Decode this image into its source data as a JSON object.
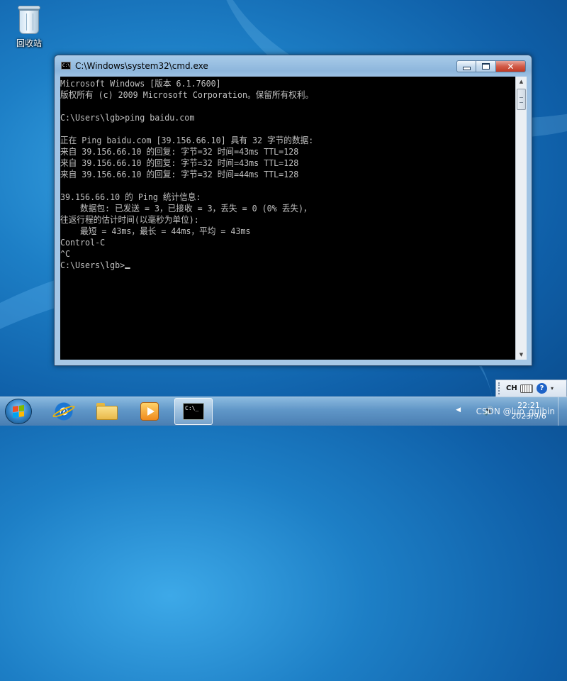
{
  "desktop": {
    "recycle_bin_label": "回收站"
  },
  "window": {
    "title": "C:\\Windows\\system32\\cmd.exe",
    "icon_text": "C:\\",
    "close_glyph": "✕"
  },
  "console": {
    "lines": [
      "Microsoft Windows [版本 6.1.7600]",
      "版权所有 (c) 2009 Microsoft Corporation。保留所有权利。",
      "",
      "C:\\Users\\lgb>ping baidu.com",
      "",
      "正在 Ping baidu.com [39.156.66.10] 具有 32 字节的数据:",
      "来自 39.156.66.10 的回复: 字节=32 时间=43ms TTL=128",
      "来自 39.156.66.10 的回复: 字节=32 时间=43ms TTL=128",
      "来自 39.156.66.10 的回复: 字节=32 时间=44ms TTL=128",
      "",
      "39.156.66.10 的 Ping 统计信息:",
      "    数据包: 已发送 = 3，已接收 = 3，丢失 = 0 (0% 丢失)，",
      "往返行程的估计时间(以毫秒为单位):",
      "    最短 = 43ms，最长 = 44ms，平均 = 43ms",
      "Control-C",
      "^C",
      "C:\\Users\\lgb>"
    ]
  },
  "language_bar": {
    "lang": "CH",
    "help": "?"
  },
  "taskbar": {
    "cmd_icon_text": "C:\\_",
    "clock_time": "22:21",
    "clock_date": "2023/9/6",
    "watermark": "CSDN @luo_guibin"
  },
  "colors": {
    "console_bg": "#000000",
    "console_fg": "#c0c0c0",
    "close_button": "#c13a24"
  },
  "icons": [
    "recycle-bin-icon",
    "cmd-icon",
    "minimize-icon",
    "maximize-icon",
    "close-icon",
    "windows-start-icon",
    "internet-explorer-icon",
    "explorer-folder-icon",
    "media-player-icon",
    "keyboard-icon",
    "help-icon",
    "volume-icon",
    "network-icon"
  ]
}
